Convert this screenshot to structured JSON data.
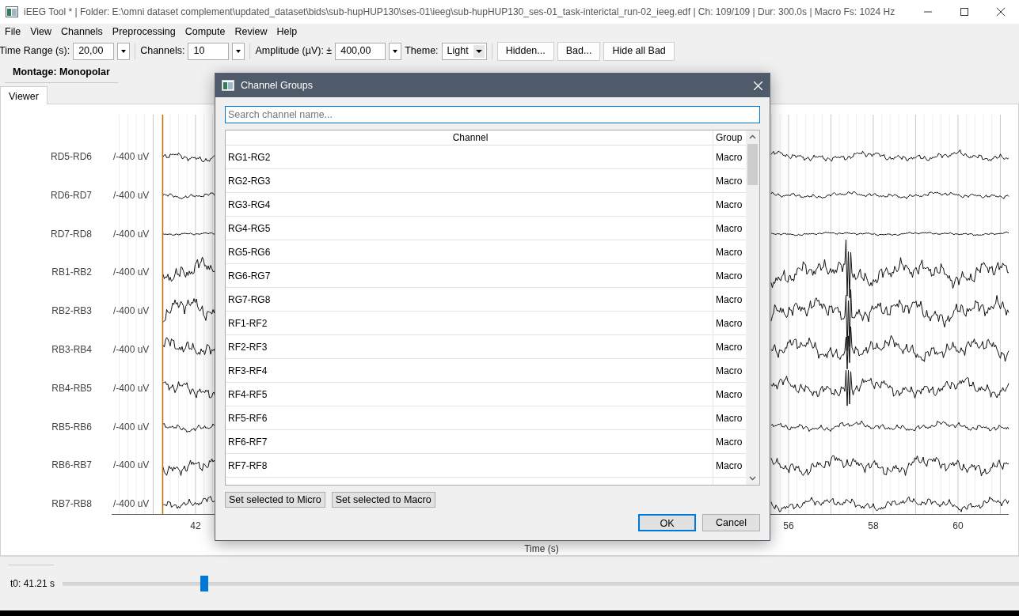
{
  "window": {
    "title": "iEEG Tool * | Folder: E:\\omni dataset complement\\updated_dataset\\bids\\sub-hupHUP130\\ses-01\\ieeg\\sub-hupHUP130_ses-01_task-interictal_run-02_ieeg.edf | Ch: 109/109 | Dur: 300.0s | Macro Fs: 1024 Hz"
  },
  "menu": [
    "File",
    "View",
    "Channels",
    "Preprocessing",
    "Compute",
    "Review",
    "Help"
  ],
  "toolbar": {
    "time_range": {
      "label": "Time Range (s):",
      "value": "20,00"
    },
    "channels": {
      "label": "Channels:",
      "value": "10"
    },
    "amplitude": {
      "label": "Amplitude (µV): ±",
      "value": "400,00"
    },
    "theme": {
      "label": "Theme:",
      "value": "Light"
    },
    "buttons": [
      "Hidden...",
      "Bad...",
      "Hide all Bad"
    ]
  },
  "montage": "Montage: Monopolar",
  "tabs": [
    {
      "label": "Viewer",
      "selected": true
    }
  ],
  "plot": {
    "channels": [
      {
        "name": "RD5-RD6",
        "scale": "/-400 uV"
      },
      {
        "name": "RD6-RD7",
        "scale": "/-400 uV"
      },
      {
        "name": "RD7-RD8",
        "scale": "/-400 uV"
      },
      {
        "name": "RB1-RB2",
        "scale": "/-400 uV"
      },
      {
        "name": "RB2-RB3",
        "scale": "/-400 uV"
      },
      {
        "name": "RB3-RB4",
        "scale": "/-400 uV"
      },
      {
        "name": "RB4-RB5",
        "scale": "/-400 uV"
      },
      {
        "name": "RB5-RB6",
        "scale": "/-400 uV"
      },
      {
        "name": "RB6-RB7",
        "scale": "/-400 uV"
      },
      {
        "name": "RB7-RB8",
        "scale": "/-400 uV"
      }
    ],
    "xticks": [
      "42",
      "56",
      "58",
      "60"
    ],
    "xlabel": "Time (s)"
  },
  "slider": {
    "label": "t0: 41.21 s",
    "level": 0.148
  },
  "dialog": {
    "title": "Channel Groups",
    "search": {
      "placeholder": "Search channel name..."
    },
    "columns": [
      "Channel",
      "Group"
    ],
    "rows": [
      {
        "channel": "RG1-RG2",
        "group": "Macro"
      },
      {
        "channel": "RG2-RG3",
        "group": "Macro"
      },
      {
        "channel": "RG3-RG4",
        "group": "Macro"
      },
      {
        "channel": "RG4-RG5",
        "group": "Macro"
      },
      {
        "channel": "RG5-RG6",
        "group": "Macro"
      },
      {
        "channel": "RG6-RG7",
        "group": "Macro"
      },
      {
        "channel": "RG7-RG8",
        "group": "Macro"
      },
      {
        "channel": "RF1-RF2",
        "group": "Macro"
      },
      {
        "channel": "RF2-RF3",
        "group": "Macro"
      },
      {
        "channel": "RF3-RF4",
        "group": "Macro"
      },
      {
        "channel": "RF4-RF5",
        "group": "Macro"
      },
      {
        "channel": "RF5-RF6",
        "group": "Macro"
      },
      {
        "channel": "RF6-RF7",
        "group": "Macro"
      },
      {
        "channel": "RF7-RF8",
        "group": "Macro"
      }
    ],
    "buttons": [
      "Set selected to Micro",
      "Set selected to Macro"
    ],
    "ok": "OK",
    "cancel": "Cancel"
  }
}
